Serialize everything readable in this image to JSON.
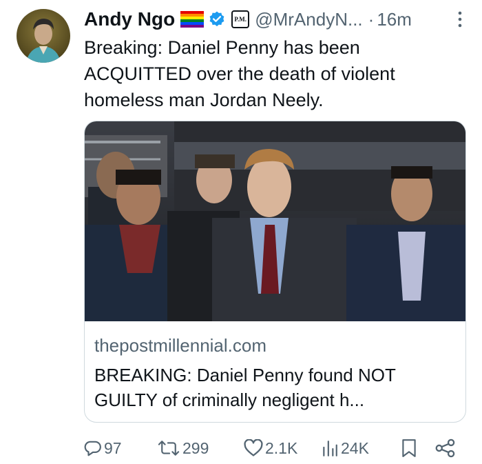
{
  "author": {
    "name": "Andy Ngo",
    "handle": "@MrAndyN...",
    "separator": "·",
    "time": "16m",
    "affiliate_badge": "P.M."
  },
  "tweet": {
    "text": "Breaking: Daniel Penny has been ACQUITTED over the death of violent homeless man Jordan Neely."
  },
  "card": {
    "domain": "thepostmillennial.com",
    "title": "BREAKING: Daniel Penny found NOT GUILTY of criminally negligent h..."
  },
  "actions": {
    "replies": "97",
    "reposts": "299",
    "likes": "2.1K",
    "views": "24K"
  },
  "colors": {
    "text": "#0f1419",
    "secondary": "#536471",
    "verified": "#1d9bf0",
    "border": "#cfd9de"
  },
  "icons": [
    "more-icon",
    "verified-icon",
    "reply-icon",
    "repost-icon",
    "like-icon",
    "views-icon",
    "bookmark-icon",
    "share-icon"
  ]
}
